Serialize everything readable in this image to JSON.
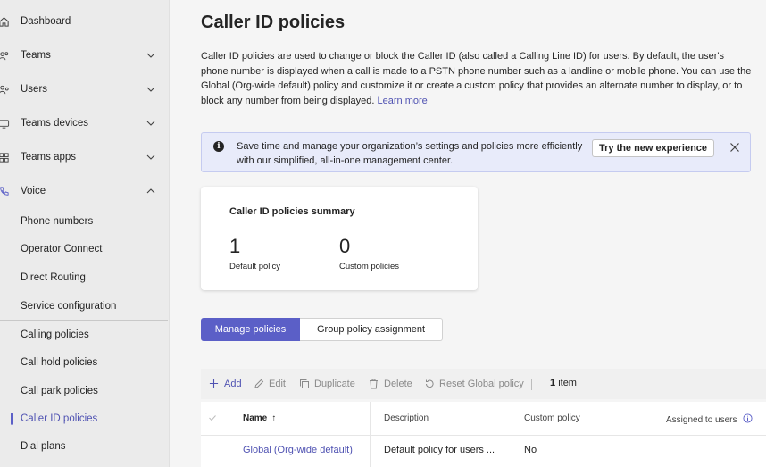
{
  "sidebar": {
    "top_items": [
      {
        "label": "Dashboard",
        "icon": "home-icon"
      },
      {
        "label": "Teams",
        "icon": "teams-icon"
      },
      {
        "label": "Users",
        "icon": "users-icon"
      },
      {
        "label": "Teams devices",
        "icon": "devices-icon"
      },
      {
        "label": "Teams apps",
        "icon": "apps-icon"
      },
      {
        "label": "Voice",
        "icon": "phone-icon"
      }
    ],
    "voice_items": [
      {
        "label": "Phone numbers"
      },
      {
        "label": "Operator Connect"
      },
      {
        "label": "Direct Routing"
      },
      {
        "label": "Service configuration"
      },
      {
        "label": "Calling policies"
      },
      {
        "label": "Call hold policies"
      },
      {
        "label": "Call park policies"
      },
      {
        "label": "Caller ID policies",
        "active": true
      },
      {
        "label": "Dial plans"
      }
    ]
  },
  "page": {
    "title": "Caller ID policies",
    "description": "Caller ID policies are used to change or block the Caller ID (also called a Calling Line ID) for users. By default, the user's phone number is displayed when a call is made to a PSTN phone number such as a landline or mobile phone. You can use the Global (Org-wide default) policy and customize it or create a custom policy that provides an alternate number to display, or to block any number from being displayed.",
    "learn_more": "Learn more"
  },
  "banner": {
    "text": "Save time and manage your organization’s settings and policies more efficiently with our simplified, all-in-one management center.",
    "button": "Try the new experience"
  },
  "summary": {
    "title": "Caller ID policies summary",
    "default_count": "1",
    "default_label": "Default policy",
    "custom_count": "0",
    "custom_label": "Custom policies"
  },
  "tabs": [
    {
      "label": "Manage policies",
      "active": true
    },
    {
      "label": "Group policy assignment",
      "active": false
    }
  ],
  "toolbar": {
    "add": "Add",
    "edit": "Edit",
    "duplicate": "Duplicate",
    "delete": "Delete",
    "reset": "Reset Global policy",
    "count_num": "1",
    "count_label": "item"
  },
  "table": {
    "headers": {
      "name": "Name",
      "sort_indicator": "↑",
      "description": "Description",
      "custom": "Custom policy",
      "assigned": "Assigned to users"
    },
    "rows": [
      {
        "name": "Global (Org-wide default)",
        "description": "Default policy for users ...",
        "custom": "No"
      }
    ]
  }
}
